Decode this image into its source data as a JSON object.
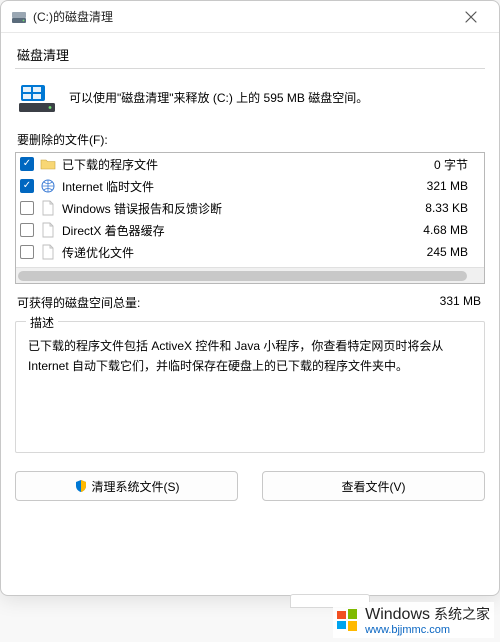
{
  "window": {
    "title": "(C:)的磁盘清理"
  },
  "tab": {
    "label": "磁盘清理"
  },
  "intro": {
    "text": "可以使用\"磁盘清理\"来释放  (C:) 上的 595 MB 磁盘空间。"
  },
  "filesSection": {
    "label": "要删除的文件(F):"
  },
  "files": [
    {
      "checked": true,
      "icon": "folder",
      "name": "已下载的程序文件",
      "size": "0 字节"
    },
    {
      "checked": true,
      "icon": "globe",
      "name": "Internet 临时文件",
      "size": "321 MB"
    },
    {
      "checked": false,
      "icon": "file",
      "name": "Windows 错误报告和反馈诊断",
      "size": "8.33 KB"
    },
    {
      "checked": false,
      "icon": "file",
      "name": "DirectX 着色器缓存",
      "size": "4.68 MB"
    },
    {
      "checked": false,
      "icon": "file",
      "name": "传递优化文件",
      "size": "245 MB"
    }
  ],
  "total": {
    "label": "可获得的磁盘空间总量:",
    "value": "331 MB"
  },
  "description": {
    "legend": "描述",
    "text": "已下载的程序文件包括 ActiveX 控件和 Java 小程序，你查看特定网页时将会从 Internet 自动下载它们，并临时保存在硬盘上的已下载的程序文件夹中。"
  },
  "buttons": {
    "cleanSystem": "清理系统文件(S)",
    "viewFiles": "查看文件(V)"
  },
  "watermark": {
    "brand": "Windows",
    "sub": "系统之家",
    "url": "www.bjjmmc.com"
  }
}
